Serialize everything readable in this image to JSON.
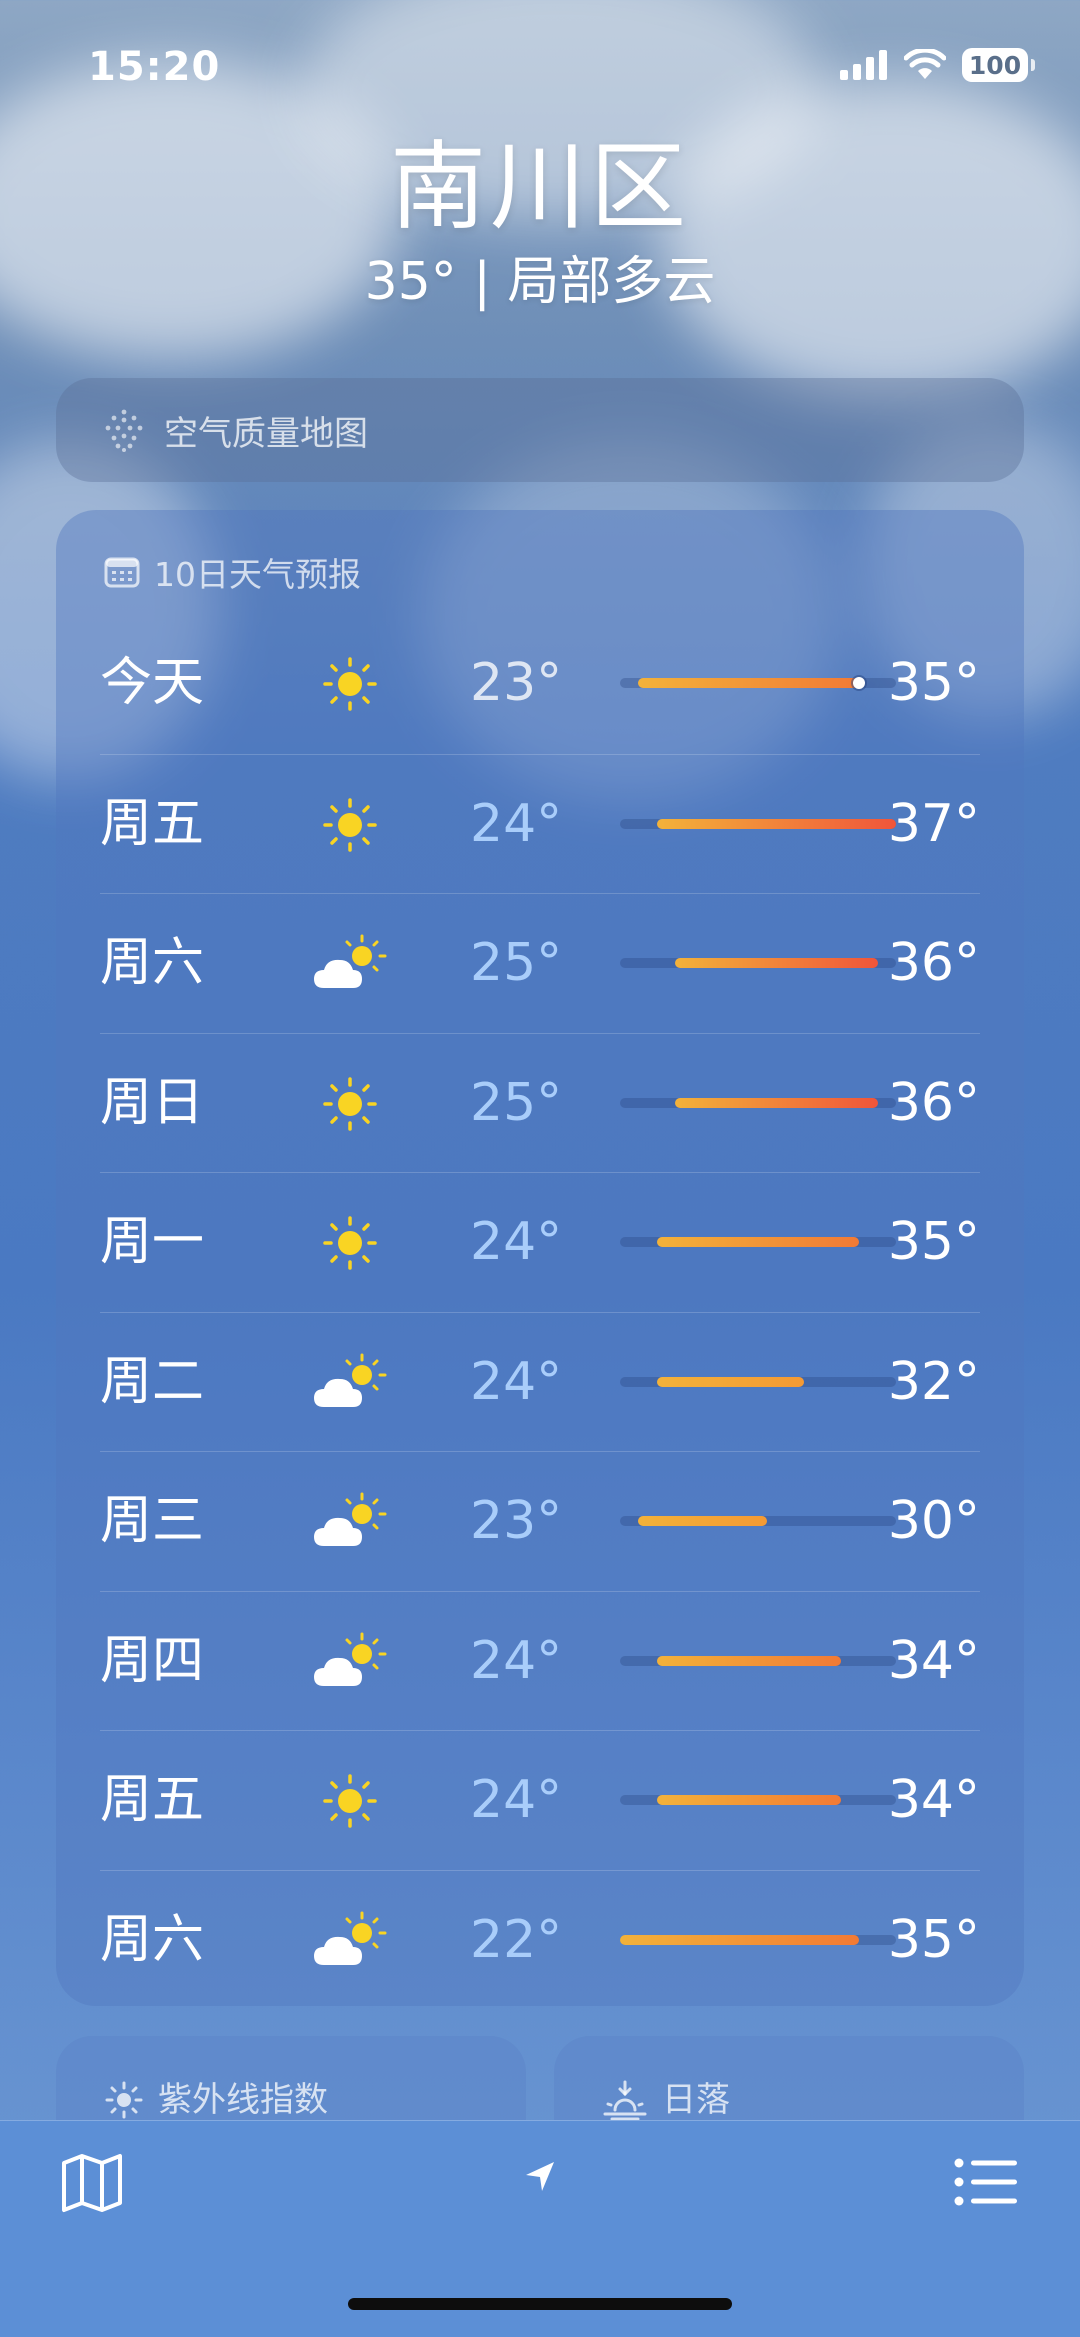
{
  "status_bar": {
    "time": "15:20",
    "battery": "100"
  },
  "header": {
    "location": "南川区",
    "subtitle": "35° | 局部多云"
  },
  "air_quality": {
    "label": "空气质量地图"
  },
  "forecast": {
    "title": "10日天气预报",
    "range_min": 22,
    "range_max": 37,
    "current_temp": 35,
    "days": [
      {
        "day": "今天",
        "icon": "sun-icon",
        "low": "23°",
        "high": "35°",
        "low_val": 23,
        "high_val": 35,
        "today": true
      },
      {
        "day": "周五",
        "icon": "sun-icon",
        "low": "24°",
        "high": "37°",
        "low_val": 24,
        "high_val": 37
      },
      {
        "day": "周六",
        "icon": "partly-cloudy-icon",
        "low": "25°",
        "high": "36°",
        "low_val": 25,
        "high_val": 36
      },
      {
        "day": "周日",
        "icon": "sun-icon",
        "low": "25°",
        "high": "36°",
        "low_val": 25,
        "high_val": 36
      },
      {
        "day": "周一",
        "icon": "sun-icon",
        "low": "24°",
        "high": "35°",
        "low_val": 24,
        "high_val": 35
      },
      {
        "day": "周二",
        "icon": "partly-cloudy-icon",
        "low": "24°",
        "high": "32°",
        "low_val": 24,
        "high_val": 32
      },
      {
        "day": "周三",
        "icon": "partly-cloudy-icon",
        "low": "23°",
        "high": "30°",
        "low_val": 23,
        "high_val": 30
      },
      {
        "day": "周四",
        "icon": "partly-cloudy-icon",
        "low": "24°",
        "high": "34°",
        "low_val": 24,
        "high_val": 34
      },
      {
        "day": "周五",
        "icon": "sun-icon",
        "low": "24°",
        "high": "34°",
        "low_val": 24,
        "high_val": 34
      },
      {
        "day": "周六",
        "icon": "partly-cloudy-icon",
        "low": "22°",
        "high": "35°",
        "low_val": 22,
        "high_val": 35
      }
    ]
  },
  "cards": {
    "uv_label": "紫外线指数",
    "sunset_label": "日落"
  },
  "tab_bar": {
    "left_icon": "map-icon",
    "center_icon": "location-arrow-icon",
    "right_icon": "list-icon"
  }
}
